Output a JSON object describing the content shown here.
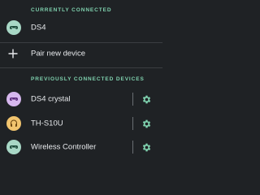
{
  "colors": {
    "background": "#1f2225",
    "accent": "#7fd1ae",
    "text": "#e8eaed",
    "icon_gamepad_bg": "#a8d8c6",
    "icon_gamepad_fg": "#1c4a3a",
    "icon_crystal_bg": "#d6b7ee",
    "icon_crystal_fg": "#5a2a7a",
    "icon_headphones_bg": "#f1c46e",
    "icon_headphones_fg": "#6a4510",
    "divider": "#3a3d41"
  },
  "currently_connected": {
    "header": "CURRENTLY CONNECTED",
    "devices": [
      {
        "name": "DS4",
        "icon": "gamepad-icon"
      }
    ]
  },
  "pair_new": {
    "label": "Pair new device",
    "icon": "plus-icon"
  },
  "previously_connected": {
    "header": "PREVIOUSLY CONNECTED DEVICES",
    "devices": [
      {
        "name": "DS4 crystal",
        "icon": "gamepad-icon",
        "settings_icon": "gear-icon"
      },
      {
        "name": "TH-S10U",
        "icon": "headphones-icon",
        "settings_icon": "gear-icon"
      },
      {
        "name": "Wireless Controller",
        "icon": "gamepad-icon",
        "settings_icon": "gear-icon"
      }
    ]
  }
}
